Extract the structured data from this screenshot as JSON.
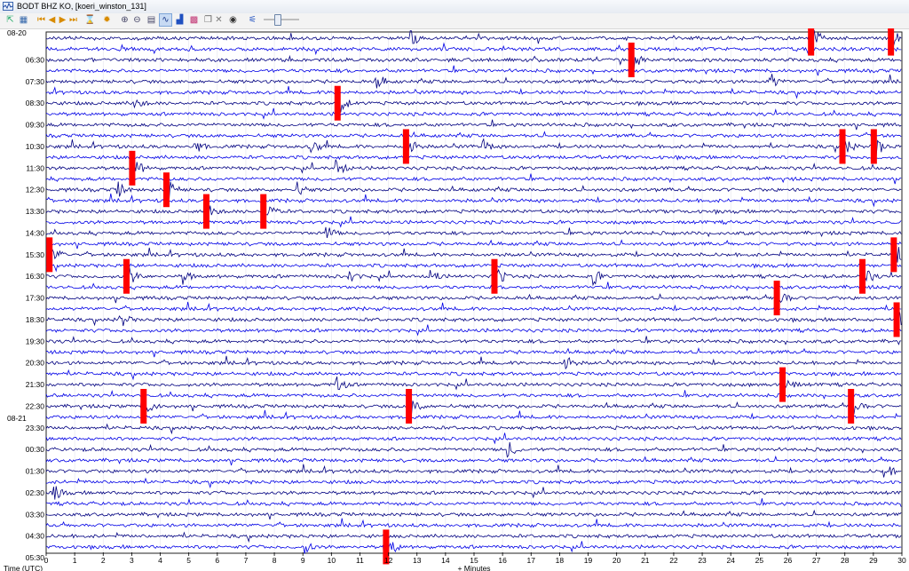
{
  "window": {
    "title": "BODT BHZ KO, [koeri_winston_131]"
  },
  "toolbar": {
    "buttons": [
      {
        "name": "export-icon",
        "glyph": "⇱"
      },
      {
        "name": "settings-icon",
        "glyph": "▦"
      },
      {
        "name": "first-icon",
        "glyph": "⏮"
      },
      {
        "name": "previous-icon",
        "glyph": "◀"
      },
      {
        "name": "next-icon",
        "glyph": "▶"
      },
      {
        "name": "last-icon",
        "glyph": "⏭"
      },
      {
        "name": "hourglass-icon",
        "glyph": "⌛"
      },
      {
        "name": "gear-icon",
        "glyph": "✹"
      },
      {
        "name": "zoom-in-icon",
        "glyph": "⊕"
      },
      {
        "name": "zoom-out-icon",
        "glyph": "⊖"
      },
      {
        "name": "clipboard-icon",
        "glyph": "▤"
      },
      {
        "name": "wave-toggle-icon",
        "glyph": "∿",
        "active": true
      },
      {
        "name": "spectrum-icon",
        "glyph": "▟"
      },
      {
        "name": "spectrogram-icon",
        "glyph": "▩"
      },
      {
        "name": "copy-icon",
        "glyph": "❐"
      },
      {
        "name": "close-icon",
        "glyph": "✕"
      },
      {
        "name": "camera-icon",
        "glyph": "◉"
      },
      {
        "name": "filter-icon",
        "glyph": "⚟"
      }
    ],
    "slider_value": 0.35
  },
  "helicorder": {
    "date_labels": [
      {
        "text": "08-20",
        "row": 0
      },
      {
        "text": "08-21",
        "row": 18
      }
    ],
    "row_labels": [
      "",
      "06:30",
      "07:30",
      "08:30",
      "09:30",
      "10:30",
      "11:30",
      "12:30",
      "13:30",
      "14:30",
      "15:30",
      "16:30",
      "17:30",
      "18:30",
      "19:30",
      "20:30",
      "21:30",
      "22:30",
      "23:30",
      "00:30",
      "01:30",
      "02:30",
      "03:30",
      "04:30",
      "05:30"
    ],
    "x_ticks": [
      "0",
      "1",
      "2",
      "3",
      "4",
      "5",
      "6",
      "7",
      "8",
      "9",
      "10",
      "11",
      "12",
      "13",
      "14",
      "15",
      "16",
      "17",
      "18",
      "19",
      "20",
      "21",
      "22",
      "23",
      "24",
      "25",
      "26",
      "27",
      "28",
      "29",
      "30"
    ],
    "x_label": "+ Minutes",
    "y_label": "Time (UTC)",
    "minutes_per_line": 30,
    "trace_count": 48,
    "trace_colors": [
      "#000080",
      "#0000e6"
    ],
    "clip_color": "#ff0000",
    "events": [
      {
        "t": 26.8,
        "row": 0,
        "clip": true
      },
      {
        "t": 29.6,
        "row": 0,
        "clip": true
      },
      {
        "t": 12.8,
        "row": 0,
        "clip": false
      },
      {
        "t": 20.5,
        "row": 1,
        "clip": true
      },
      {
        "t": 11.6,
        "row": 2,
        "clip": false
      },
      {
        "t": 25.4,
        "row": 2,
        "clip": false
      },
      {
        "t": 10.2,
        "row": 3,
        "clip": true
      },
      {
        "t": 3.1,
        "row": 3,
        "clip": false
      },
      {
        "t": 5.2,
        "row": 5,
        "clip": false
      },
      {
        "t": 12.6,
        "row": 5,
        "clip": true
      },
      {
        "t": 9.3,
        "row": 5,
        "clip": false
      },
      {
        "t": 15.3,
        "row": 5,
        "clip": false
      },
      {
        "t": 27.9,
        "row": 5,
        "clip": true
      },
      {
        "t": 29.0,
        "row": 5,
        "clip": true
      },
      {
        "t": 3.0,
        "row": 6,
        "clip": true
      },
      {
        "t": 10.2,
        "row": 6,
        "clip": false
      },
      {
        "t": 2.5,
        "row": 7,
        "clip": false
      },
      {
        "t": 4.2,
        "row": 7,
        "clip": true
      },
      {
        "t": 8.8,
        "row": 7,
        "clip": false
      },
      {
        "t": 5.6,
        "row": 8,
        "clip": true
      },
      {
        "t": 7.6,
        "row": 8,
        "clip": true
      },
      {
        "t": 9.8,
        "row": 9,
        "clip": false
      },
      {
        "t": 0.1,
        "row": 10,
        "clip": true
      },
      {
        "t": 29.7,
        "row": 10,
        "clip": true
      },
      {
        "t": 2.8,
        "row": 11,
        "clip": true
      },
      {
        "t": 4.8,
        "row": 11,
        "clip": false
      },
      {
        "t": 10.6,
        "row": 11,
        "clip": false
      },
      {
        "t": 13.5,
        "row": 11,
        "clip": false
      },
      {
        "t": 15.7,
        "row": 11,
        "clip": true
      },
      {
        "t": 19.2,
        "row": 11,
        "clip": false
      },
      {
        "t": 25.6,
        "row": 12,
        "clip": true
      },
      {
        "t": 28.6,
        "row": 11,
        "clip": true
      },
      {
        "t": 2.6,
        "row": 13,
        "clip": false
      },
      {
        "t": 29.8,
        "row": 13,
        "clip": true
      },
      {
        "t": 18.2,
        "row": 15,
        "clip": false
      },
      {
        "t": 25.8,
        "row": 16,
        "clip": true
      },
      {
        "t": 10.2,
        "row": 16,
        "clip": false
      },
      {
        "t": 3.4,
        "row": 17,
        "clip": true
      },
      {
        "t": 12.7,
        "row": 17,
        "clip": true
      },
      {
        "t": 28.2,
        "row": 17,
        "clip": true
      },
      {
        "t": 16.2,
        "row": 19,
        "clip": false
      },
      {
        "t": 29.4,
        "row": 20,
        "clip": false
      },
      {
        "t": 0.3,
        "row": 21,
        "clip": false
      },
      {
        "t": 11.9,
        "row": 24,
        "clip": true
      },
      {
        "t": 9.0,
        "row": 24,
        "clip": false
      }
    ]
  }
}
